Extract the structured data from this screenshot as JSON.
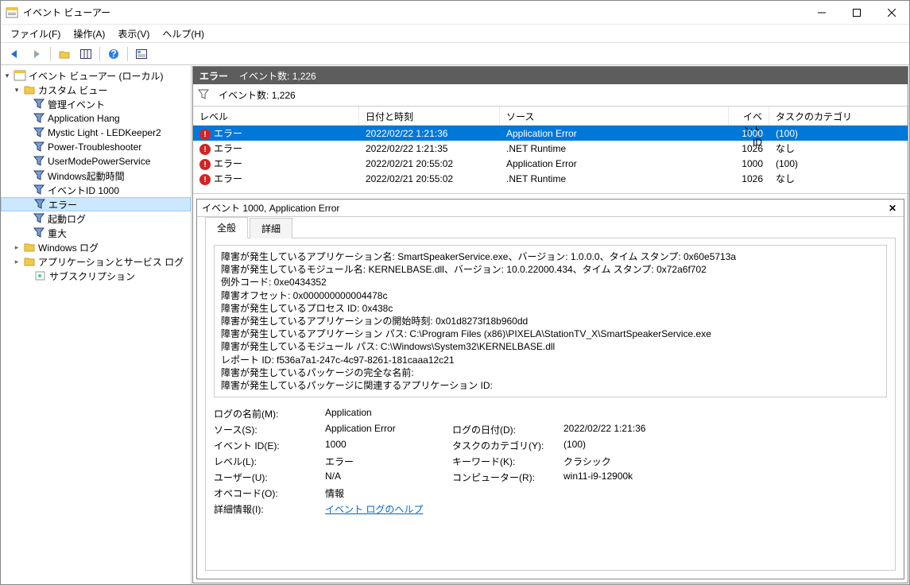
{
  "window": {
    "title": "イベント ビューアー"
  },
  "menu": {
    "file": "ファイル(F)",
    "action": "操作(A)",
    "view": "表示(V)",
    "help": "ヘルプ(H)"
  },
  "tree": {
    "root": "イベント ビューアー (ローカル)",
    "custom": "カスタム ビュー",
    "items": [
      "管理イベント",
      "Application Hang",
      "Mystic Light - LEDKeeper2",
      "Power-Troubleshooter",
      "UserModePowerService",
      "Windows起動時間",
      "イベントID 1000",
      "エラー",
      "起動ログ",
      "重大"
    ],
    "winlogs": "Windows ログ",
    "appsvc": "アプリケーションとサービス ログ",
    "subs": "サブスクリプション"
  },
  "header": {
    "title": "エラー",
    "count_label": "イベント数:",
    "count": "1,226"
  },
  "filter": {
    "count_label": "イベント数:",
    "count": "1,226"
  },
  "columns": {
    "level": "レベル",
    "date": "日付と時刻",
    "source": "ソース",
    "id": "イベント ID",
    "cat": "タスクのカテゴリ"
  },
  "rows": [
    {
      "level": "エラー",
      "date": "2022/02/22 1:21:36",
      "source": "Application Error",
      "id": "1000",
      "cat": "(100)",
      "selected": true
    },
    {
      "level": "エラー",
      "date": "2022/02/22 1:21:35",
      "source": ".NET Runtime",
      "id": "1026",
      "cat": "なし"
    },
    {
      "level": "エラー",
      "date": "2022/02/21 20:55:02",
      "source": "Application Error",
      "id": "1000",
      "cat": "(100)"
    },
    {
      "level": "エラー",
      "date": "2022/02/21 20:55:02",
      "source": ".NET Runtime",
      "id": "1026",
      "cat": "なし"
    }
  ],
  "detail": {
    "title": "イベント 1000, Application Error",
    "tabs": {
      "general": "全般",
      "details": "詳細"
    },
    "lines": [
      "障害が発生しているアプリケーション名: SmartSpeakerService.exe、バージョン: 1.0.0.0、タイム スタンプ: 0x60e5713a",
      "障害が発生しているモジュール名: KERNELBASE.dll、バージョン: 10.0.22000.434、タイム スタンプ: 0x72a6f702",
      "例外コード: 0xe0434352",
      "障害オフセット: 0x000000000004478c",
      "障害が発生しているプロセス ID: 0x438c",
      "障害が発生しているアプリケーションの開始時刻: 0x01d8273f18b960dd",
      "障害が発生しているアプリケーション パス: C:\\Program Files (x86)\\PIXELA\\StationTV_X\\SmartSpeakerService.exe",
      "障害が発生しているモジュール パス: C:\\Windows\\System32\\KERNELBASE.dll",
      "レポート ID: f536a7a1-247c-4c97-8261-181caaa12c21",
      "障害が発生しているパッケージの完全な名前:",
      "障害が発生しているパッケージに関連するアプリケーション ID:"
    ],
    "props": {
      "logname_k": "ログの名前(M):",
      "logname_v": "Application",
      "source_k": "ソース(S):",
      "source_v": "Application Error",
      "logdate_k": "ログの日付(D):",
      "logdate_v": "2022/02/22 1:21:36",
      "eventid_k": "イベント ID(E):",
      "eventid_v": "1000",
      "taskcat_k": "タスクのカテゴリ(Y):",
      "taskcat_v": "(100)",
      "level_k": "レベル(L):",
      "level_v": "エラー",
      "keyword_k": "キーワード(K):",
      "keyword_v": "クラシック",
      "user_k": "ユーザー(U):",
      "user_v": "N/A",
      "computer_k": "コンピューター(R):",
      "computer_v": "win11-i9-12900k",
      "opcode_k": "オペコード(O):",
      "opcode_v": "情報",
      "moreinfo_k": "詳細情報(I):",
      "moreinfo_link": "イベント ログのヘルプ"
    }
  }
}
